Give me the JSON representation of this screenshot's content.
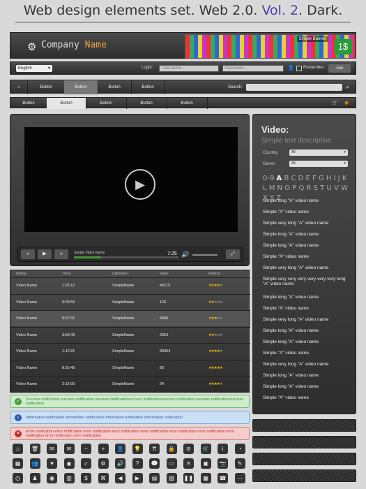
{
  "title": {
    "part1": "Web design elements set. Web 2.0. ",
    "accent": "Vol. 2",
    "part2": ". Dark."
  },
  "header": {
    "company": "Company ",
    "company_highlight": "Name",
    "banner_label": "Simple Banner",
    "banner_price": "1$"
  },
  "loginbar": {
    "language": "English",
    "login_label": "Login:",
    "username_placeholder": "Username...",
    "password_placeholder": "Password...",
    "remember_label": "Remember",
    "join_label": "Join"
  },
  "nav1": {
    "items": [
      "Button",
      "Button",
      "Button",
      "Button"
    ],
    "search_label": "Search:"
  },
  "nav2": {
    "items": [
      "Button",
      "Button",
      "Button",
      "Button",
      "Button"
    ]
  },
  "player": {
    "video_name": "Simple Video Name",
    "time": "7:25"
  },
  "table": {
    "headers": [
      "Name:",
      "Time:",
      "Uploader:",
      "View:",
      "Rating:"
    ],
    "rows": [
      {
        "name": "Video Name",
        "time": "1:26:12",
        "uploader": "SimpleName",
        "view": "45215",
        "rating": 4
      },
      {
        "name": "Video Name",
        "time": "0:09:59",
        "uploader": "SimpleName",
        "view": "126",
        "rating": 2
      },
      {
        "name": "Video Name",
        "time": "0:07:01",
        "uploader": "SimpleName",
        "view": "9945",
        "rating": 3
      },
      {
        "name": "Video Name",
        "time": "3:59:43",
        "uploader": "SimpleName",
        "view": "2654",
        "rating": 2
      },
      {
        "name": "Video Name",
        "time": "1:12:21",
        "uploader": "SimpleName",
        "view": "99954",
        "rating": 4
      },
      {
        "name": "Video Name",
        "time": "8:25:45",
        "uploader": "SimpleName",
        "view": "95",
        "rating": 5
      },
      {
        "name": "Video Name",
        "time": "2:15:00",
        "uploader": "SimpleName",
        "view": "24",
        "rating": 4
      }
    ]
  },
  "notifications": {
    "success": "Success notification success notification success notificationsuccess notificationsuccess notification-success notificationsuccess notification",
    "info": "Information notification information notification information notification information notification",
    "error": "Error notification error notification error notification error notification error notification error notification error notification error notification error notification error notification"
  },
  "sidebar": {
    "title": "Video:",
    "subtitle": "Simple text description",
    "country_label": "Country:",
    "country_value": "All",
    "genre_label": "Genre:",
    "genre_value": "All",
    "alpha_pre": "0-9 ",
    "alpha_current": "A",
    "alpha_post": " B C D E F G H I J K L M N O P Q R S T U V W X Y Z",
    "videos": [
      "Simple long \"A\" video name",
      "Simple \"A\" video name",
      "Simple very long \"A\" video name",
      "Simple long \"A\" video name",
      "Simple long \"A\" video name",
      "Simple \"A\" video name",
      "Simple very long \"A\" video name",
      "Simple very very very very very very long \"A\" video name",
      "Simple long \"A\" video name",
      "Simple \"A\" video name",
      "Simple very long \"A\" video name",
      "Simple long \"A\" video name",
      "Simple long \"A\" video name",
      "Simple \"A\" video name",
      "Simple very long \"A\" video name",
      "Simple long \"A\" video name",
      "Simple long \"A\" video name",
      "Simple \"A\" video name"
    ]
  },
  "icons": [
    "home-icon",
    "trash-icon",
    "mail-icon",
    "envelope-icon",
    "minus-icon",
    "plus-icon",
    "user-icon",
    "lightbulb-icon",
    "double-up-icon",
    "lock-icon",
    "no-entry-icon",
    "cart-icon",
    "info-icon",
    "pie-chart-icon",
    "grid-icon",
    "group-icon",
    "heart-icon",
    "rss-icon",
    "check-icon",
    "gear-icon",
    "speaker-icon",
    "question-icon",
    "chat-icon",
    "chat-bubble-icon",
    "close-icon",
    "briefcase-icon",
    "camera-icon",
    "pen-icon",
    "clock-icon",
    "person-icon",
    "eye-icon",
    "bar-chart-icon",
    "dollar-icon",
    "tag-icon",
    "arrow-left-icon",
    "arrow-right-icon",
    "folder-icon",
    "image-icon",
    "pause-icon",
    "calculator-icon",
    "phone-icon",
    "more-icon"
  ]
}
